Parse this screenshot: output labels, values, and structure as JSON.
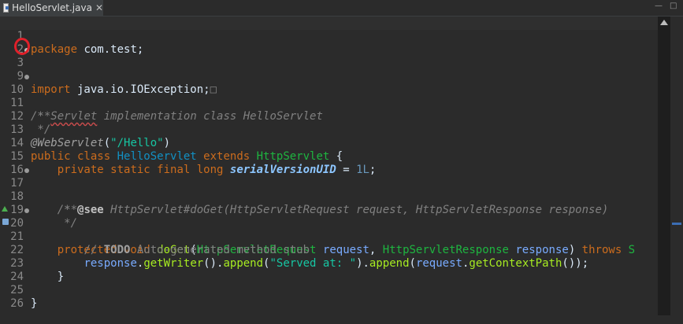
{
  "tab": {
    "filename": "HelloServlet.java",
    "close": "✕"
  },
  "window": {
    "minimize": "—",
    "maximize": "□"
  },
  "code": {
    "pkg_kw": "package",
    "pkg_name": " com.test;",
    "imp_kw": "import",
    "imp_name": " java.io.IOException;",
    "imp_fold": "□",
    "jd1": "/**",
    "jd2a": " * ",
    "jd2b": "Servlet",
    "jd2c": " implementation class HelloServlet",
    "jd3": " */",
    "ann": "@WebServlet",
    "ann_p1": "(",
    "ann_str": "\"/Hello\"",
    "ann_p2": ")",
    "c_public": "public",
    "c_class": " class ",
    "c_name": "HelloServlet",
    "c_extends": " extends ",
    "c_super": "HttpServlet",
    "c_brace": " {",
    "f_indent": "    ",
    "f_private": "private",
    "f_static": " static",
    "f_final": " final",
    "f_long": " long ",
    "f_name": "serialVersionUID",
    "f_eq": " = ",
    "f_val": "1L",
    "f_semi": ";",
    "j17": "    /**",
    "j18a": "     * ",
    "j18b": "@see",
    "j18c": " HttpServlet#doGet(HttpServletRequest request, HttpServletResponse response)",
    "j19": "     */",
    "m_indent": "    ",
    "m_protected": "protected",
    "m_void": " void ",
    "m_name": "doGet",
    "m_p1": "(",
    "m_t1": "HttpServletRequest",
    "m_sp1": " ",
    "m_v1": "request",
    "m_comma": ", ",
    "m_t2": "HttpServletResponse",
    "m_sp2": " ",
    "m_v2": "response",
    "m_p2": ") ",
    "m_throws": "throws",
    "m_rest": " S",
    "t_indent": "        ",
    "t_slash": "// ",
    "t_todo": "TODO",
    "t_text": " Auto-generated method stub",
    "r_indent": "        ",
    "r_var": "response",
    "r_a": ".",
    "r_m1": "getWriter",
    "r_b": "().",
    "r_m2": "append",
    "r_c": "(",
    "r_str": "\"Served at: \"",
    "r_d": ").",
    "r_m3": "append",
    "r_e": "(",
    "r_v2": "request",
    "r_f": ".",
    "r_m4": "getContextPath",
    "r_g": "());",
    "close_method": "    }",
    "close_class": "}"
  },
  "line_numbers": [
    "1",
    "2",
    "3",
    "9",
    "10",
    "11",
    "12",
    "13",
    "14",
    "15",
    "16",
    "17",
    "18",
    "19",
    "20",
    "21",
    "22",
    "23",
    "24",
    "25",
    "26"
  ]
}
